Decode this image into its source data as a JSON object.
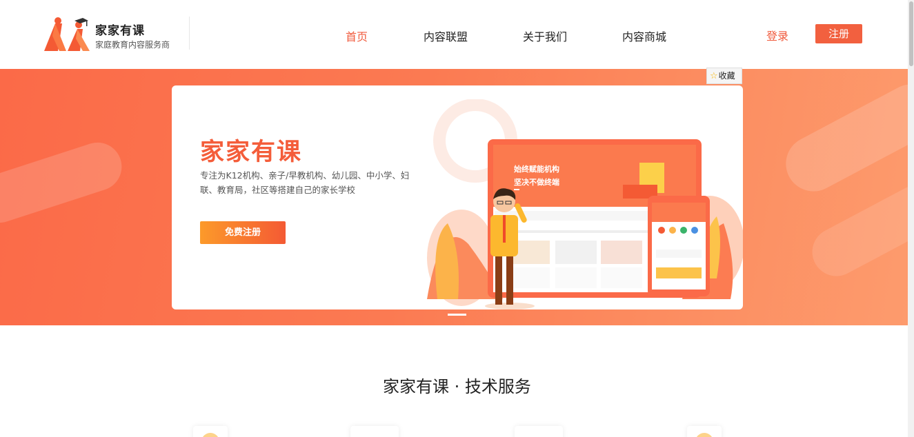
{
  "brand": {
    "name": "家家有课",
    "subtitle": "家庭教育内容服务商"
  },
  "nav": [
    {
      "label": "首页",
      "active": true
    },
    {
      "label": "内容联盟",
      "active": false
    },
    {
      "label": "关于我们",
      "active": false
    },
    {
      "label": "内容商城",
      "active": false
    }
  ],
  "auth": {
    "login_label": "登录",
    "register_label": "注册"
  },
  "favorite": {
    "label": "收藏",
    "icon": "star-icon"
  },
  "banner": {
    "title": "家家有课",
    "description": "专注为K12机构、亲子/早教机构、幼儿园、中小学、妇联、教育局，社区等搭建自己的家长学校",
    "cta_label": "免费注册",
    "illustration": {
      "headline_line1": "始终赋能机构",
      "headline_line2": "坚决不做终端"
    }
  },
  "section": {
    "title": "家家有课 · 技术服务"
  },
  "colors": {
    "accent": "#f05a3c",
    "banner_start": "#fb6a48",
    "banner_end": "#fd9b6d",
    "cta_start": "#fc9a2a"
  }
}
